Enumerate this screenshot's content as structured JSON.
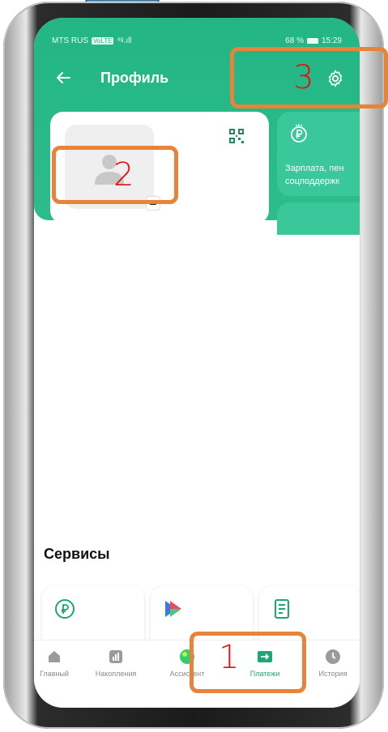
{
  "status_bar": {
    "carrier": "MTS RUS",
    "network_badge": "VoLTE",
    "signal": "⁴ᵍ.ıll",
    "battery_percent": "68 %",
    "time": "15:29"
  },
  "header": {
    "title": "Профиль"
  },
  "side_card": {
    "line1": "Зарплата, пен",
    "line2": "соцподдержк"
  },
  "services": {
    "title": "Сервисы"
  },
  "nav": {
    "items": [
      {
        "label": "Главный",
        "icon": "home-icon"
      },
      {
        "label": "Накопления",
        "icon": "chart-icon"
      },
      {
        "label": "Ассистент",
        "icon": "assistant-icon"
      },
      {
        "label": "Платежи",
        "icon": "payments-icon",
        "active": true
      },
      {
        "label": "История",
        "icon": "clock-icon"
      }
    ]
  },
  "annotations": {
    "n1": "1",
    "n2": "2",
    "n3": "3"
  },
  "colors": {
    "brand_green": "#23b584",
    "annotation_orange": "#e8833a",
    "annotation_red": "#e60f0f",
    "arrow_green": "#86c9a2"
  }
}
